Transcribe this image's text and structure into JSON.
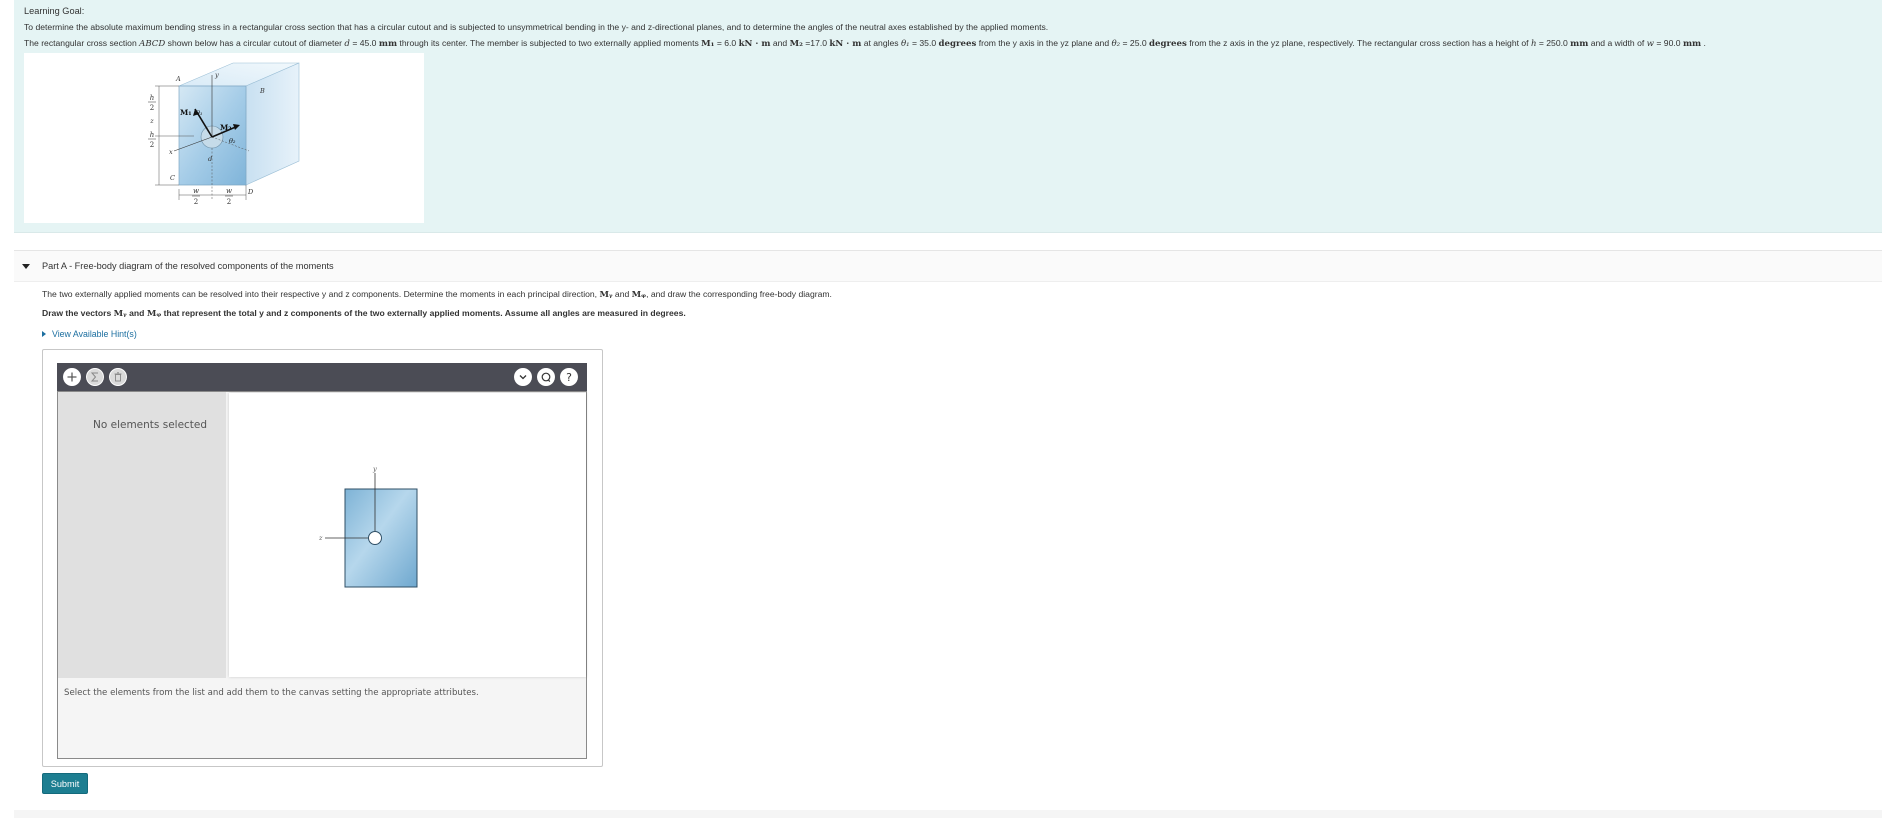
{
  "learning_goal": {
    "title": "Learning Goal:",
    "line1": "To determine the absolute maximum bending stress in a rectangular cross section that has a circular cutout and is subjected to unsymmetrical bending in the y- and z-directional planes, and to determine the angles of the neutral axes established by the applied moments.",
    "line2": {
      "p1": "The rectangular cross section ",
      "abcd": "ABCD",
      "p2": " shown below has a circular cutout of diameter ",
      "d_var": "d",
      "d_val": " = 45.0 ",
      "d_unit": "mm",
      "p3": " through its center. The member is subjected to two externally applied moments ",
      "m1": "M₁",
      "m1_val": " = 6.0 ",
      "m1_unit": "kN · m",
      "p4": " and ",
      "m2": "M₂",
      "m2_val": " =17.0 ",
      "m2_unit": "kN · m",
      "p5": " at angles ",
      "t1": "θ₁",
      "t1_val": " = 35.0 ",
      "t1_unit": "degrees",
      "p6": " from the y axis in the yz plane and ",
      "t2": "θ₂",
      "t2_val": " = 25.0 ",
      "t2_unit": "degrees",
      "p7": " from the z axis in the yz plane, respectively. The rectangular cross section has a height of ",
      "h_var": "h",
      "h_val": " = 250.0 ",
      "h_unit": "mm",
      "p8": " and a width of ",
      "w_var": "w",
      "w_val": " = 90.0 ",
      "w_unit": "mm",
      "p9": " ."
    },
    "figure_labels": {
      "A": "A",
      "B": "B",
      "C": "C",
      "D": "D",
      "y": "y",
      "z": "z",
      "x": "x",
      "d": "d",
      "h": "h",
      "two": "2",
      "w": "w",
      "M1": "M₁",
      "M2": "M₂",
      "theta1": "θ₁",
      "theta2": "θ₂"
    }
  },
  "part_a": {
    "title": "Part A - Free-body diagram of the resolved components of the moments",
    "body": {
      "p1": "The two externally applied moments can be resolved into their respective y and z components. Determine the moments in each principal direction, ",
      "my": "Mᵧ",
      "p2": " and ",
      "mz": "Mᵩ",
      "p3": ", and draw the corresponding free-body diagram."
    },
    "bold": {
      "p1": "Draw the vectors ",
      "my": "Mᵧ",
      "p2": " and ",
      "mz": "Mᵩ",
      "p3": " that represent the total y and z components of the two externally applied moments. Assume all angles are measured in degrees."
    },
    "hint_label": "View Available Hint(s)"
  },
  "tool": {
    "toolbar_icons": [
      "plus-icon",
      "sigma-icon",
      "trash-icon",
      "chevron-down-icon",
      "reset-icon",
      "help-icon"
    ],
    "no_elements": "No elements selected",
    "instruction": "Select the elements from the list and add them to the canvas setting the appropriate attributes.",
    "canvas_labels": {
      "y": "y",
      "z": "z"
    }
  },
  "submit_label": "Submit",
  "colors": {
    "goal_bg": "#e5f4f4",
    "block_blue": "#a8cde6",
    "submit_bg": "#1d7e91",
    "toolbar_bg": "#4b4c55",
    "hint_link": "#1c6fa0"
  }
}
